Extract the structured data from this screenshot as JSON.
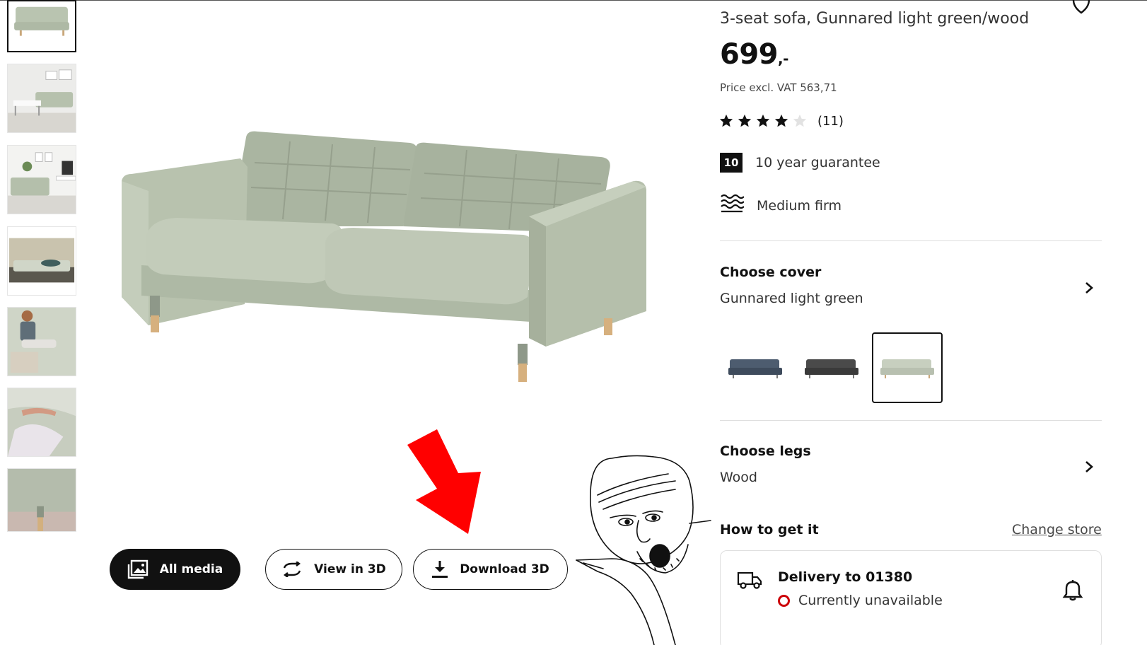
{
  "colors": {
    "sofa": "#b9c4b0",
    "accent": "#111111",
    "arrow": "#ff0000",
    "status_unavailable": "#cc0008"
  },
  "thumbnails": [
    {
      "name": "product-front",
      "active": true
    },
    {
      "name": "living-room-scene"
    },
    {
      "name": "room-with-tv"
    },
    {
      "name": "person-reclining"
    },
    {
      "name": "person-sitting"
    },
    {
      "name": "hand-on-cushion"
    },
    {
      "name": "leg-detail"
    }
  ],
  "media_buttons": {
    "all_media": "All media",
    "view_3d": "View in 3D",
    "download_3d": "Download 3D"
  },
  "product": {
    "title": "3-seat sofa, Gunnared light green/wood",
    "price": "699",
    "price_suffix": ",-",
    "vat": "Price excl. VAT 563,71",
    "rating": 4,
    "rating_max": 5,
    "reviews": "(11)"
  },
  "features": {
    "guarantee_badge": "10",
    "guarantee": "10 year guarantee",
    "firmness_icon": "waves-icon",
    "firmness": "Medium firm"
  },
  "cover": {
    "title": "Choose cover",
    "value": "Gunnared light green",
    "swatches": [
      {
        "name": "swatch-dark-blue",
        "color": "#4d5c6f"
      },
      {
        "name": "swatch-dark-grey",
        "color": "#4a4a4a"
      },
      {
        "name": "swatch-light-green",
        "color": "#c7cfbf",
        "selected": true
      }
    ]
  },
  "legs": {
    "title": "Choose legs",
    "value": "Wood"
  },
  "delivery": {
    "section_title": "How to get it",
    "change_store": "Change store",
    "title": "Delivery to 01380",
    "status": "Currently unavailable"
  }
}
